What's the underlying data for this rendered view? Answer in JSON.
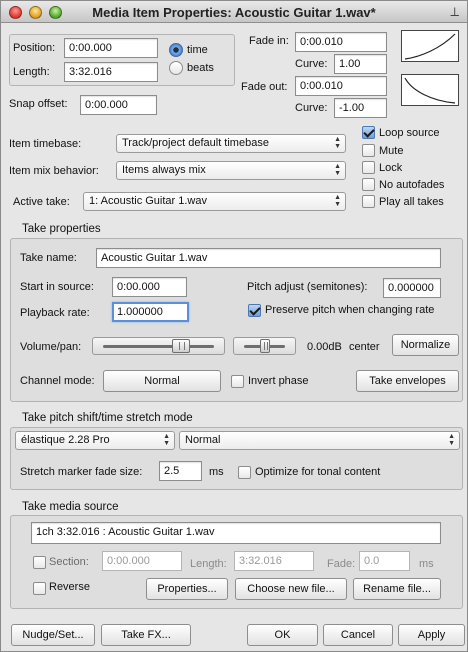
{
  "window": {
    "title": "Media Item Properties:  Acoustic Guitar 1.wav*"
  },
  "item": {
    "position_label": "Position:",
    "position_value": "0:00.000",
    "length_label": "Length:",
    "length_value": "3:32.016",
    "time_label": "time",
    "beats_label": "beats",
    "snap_label": "Snap offset:",
    "snap_value": "0:00.000"
  },
  "fades": {
    "fade_in_label": "Fade in:",
    "fade_in_value": "0:00.010",
    "curve_in_label": "Curve:",
    "curve_in_value": "1.00",
    "fade_out_label": "Fade out:",
    "fade_out_value": "0:00.010",
    "curve_out_label": "Curve:",
    "curve_out_value": "-1.00"
  },
  "selects": {
    "timebase_label": "Item timebase:",
    "timebase_value": "Track/project default timebase",
    "mix_label": "Item mix behavior:",
    "mix_value": "Items always mix",
    "take_label": "Active take:",
    "take_value": "1: Acoustic Guitar 1.wav"
  },
  "options": {
    "loop_source": "Loop source",
    "mute": "Mute",
    "lock": "Lock",
    "no_autofades": "No autofades",
    "play_all_takes": "Play all takes"
  },
  "take_props": {
    "title": "Take properties",
    "name_label": "Take name:",
    "name_value": "Acoustic Guitar 1.wav",
    "start_label": "Start in source:",
    "start_value": "0:00.000",
    "pitch_label": "Pitch adjust (semitones):",
    "pitch_value": "0.000000",
    "rate_label": "Playback rate:",
    "rate_value": "1.000000",
    "preserve_label": "Preserve pitch when changing rate",
    "volpan_label": "Volume/pan:",
    "vol_readout": "0.00dB",
    "pan_readout": "center",
    "normalize_label": "Normalize",
    "channel_label": "Channel mode:",
    "channel_value": "Normal",
    "invert_label": "Invert phase",
    "envelopes_label": "Take envelopes"
  },
  "pitch_shift": {
    "title": "Take pitch shift/time stretch mode",
    "algo_value": "élastique 2.28 Pro",
    "mode_value": "Normal",
    "fade_label": "Stretch marker fade size:",
    "fade_value": "2.5",
    "fade_unit": "ms",
    "optimize_label": "Optimize for tonal content"
  },
  "media_source": {
    "title": "Take media source",
    "source_value": "1ch 3:32.016 : Acoustic Guitar 1.wav",
    "section_label": "Section:",
    "section_value": "0:00.000",
    "length_label": "Length:",
    "length_value": "3:32.016",
    "fade_label": "Fade:",
    "fade_value": "0.0",
    "fade_unit": "ms",
    "reverse_label": "Reverse",
    "properties_label": "Properties...",
    "choose_label": "Choose new file...",
    "rename_label": "Rename file..."
  },
  "footer": {
    "nudge_label": "Nudge/Set...",
    "fx_label": "Take FX...",
    "ok_label": "OK",
    "cancel_label": "Cancel",
    "apply_label": "Apply"
  },
  "state": {
    "volume_level": 0.7,
    "pan_level": 0.5,
    "radio_time": true,
    "loop_source": true,
    "preserve_pitch": true
  },
  "colors": {
    "focus_ring": "#5b8fd8",
    "check_accent": "#6e9ed9"
  }
}
